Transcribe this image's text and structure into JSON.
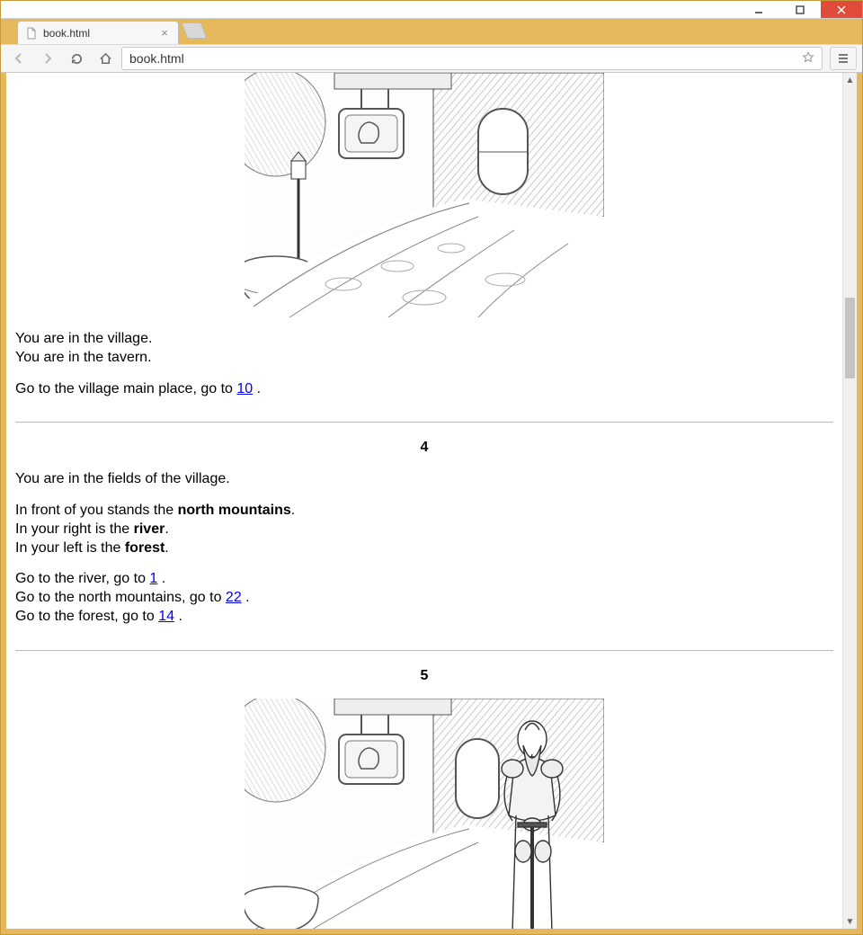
{
  "window": {
    "tab_title": "book.html",
    "url": "book.html"
  },
  "section3": {
    "line1": "You are in the village.",
    "line2": "You are in the tavern.",
    "choice1_pre": "Go to the village main place, go to ",
    "choice1_link": "10",
    "choice1_post": " ."
  },
  "section4": {
    "number": "4",
    "line1": "You are in the fields of the village.",
    "line2_pre": "In front of you stands the ",
    "line2_bold": "north mountains",
    "line2_post": ".",
    "line3_pre": "In your right is the ",
    "line3_bold": "river",
    "line3_post": ".",
    "line4_pre": "In your left is the ",
    "line4_bold": "forest",
    "line4_post": ".",
    "choice1_pre": "Go to the river, go to ",
    "choice1_link": "1",
    "choice1_post": " .",
    "choice2_pre": "Go to the north mountains, go to ",
    "choice2_link": "22",
    "choice2_post": " .",
    "choice3_pre": "Go to the forest, go to ",
    "choice3_link": "14",
    "choice3_post": " ."
  },
  "section5": {
    "number": "5"
  }
}
